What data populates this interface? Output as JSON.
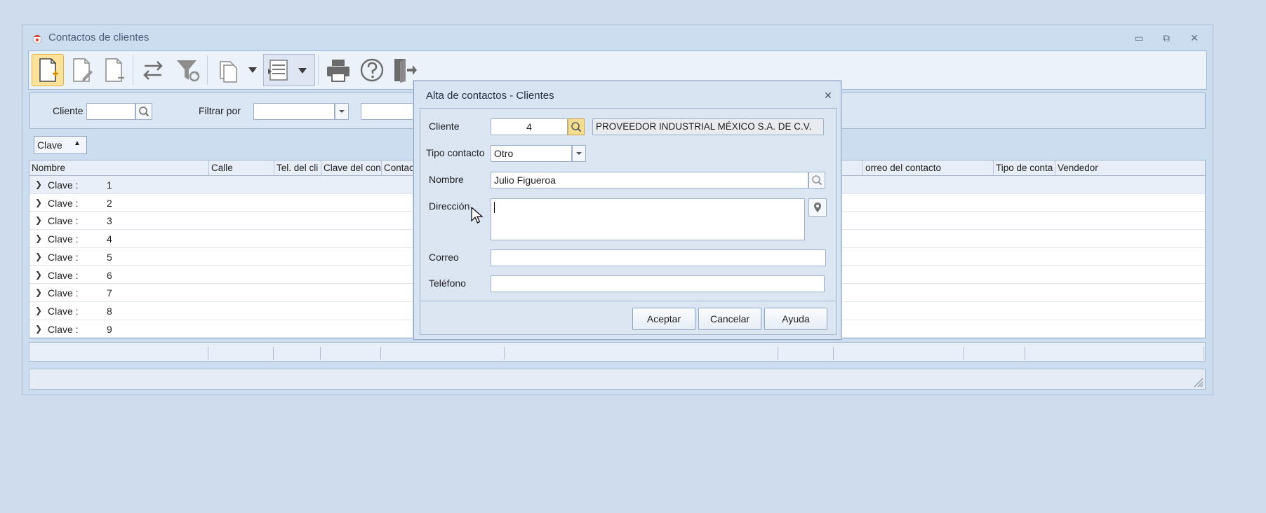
{
  "window": {
    "title": "Contactos de clientes",
    "minimize": "▭",
    "maximize": "⧉",
    "close": "✕"
  },
  "toolbar": {
    "buttons": [
      "new-document-icon",
      "edit-document-icon",
      "delete-document-icon",
      "swap-arrows-icon",
      "filter-refresh-icon",
      "copy-icon",
      "layout-icon",
      "print-icon",
      "help-icon",
      "exit-icon"
    ]
  },
  "filter": {
    "cliente_label": "Cliente",
    "cliente_value": "",
    "filtrar_label": "Filtrar por",
    "filtrar_value": "",
    "extra_value": ""
  },
  "group": {
    "label": "Clave",
    "arrow": "▲"
  },
  "grid": {
    "columns": [
      "Nombre",
      "Calle",
      "Tel. del cli",
      "Clave del con",
      "Contac",
      "orreo del contacto",
      "Tipo de conta",
      "Vendedor"
    ],
    "row_key": "Clave :",
    "rows": [
      "1",
      "2",
      "3",
      "4",
      "5",
      "6",
      "7",
      "8",
      "9"
    ]
  },
  "dialog": {
    "title": "Alta de contactos - Clientes",
    "close": "✕",
    "cliente_label": "Cliente",
    "cliente_value": "4",
    "cliente_name": "PROVEEDOR INDUSTRIAL MÉXICO S.A. DE C.V.",
    "tipo_label": "Tipo contacto",
    "tipo_value": "Otro",
    "nombre_label": "Nombre",
    "nombre_value": "Julio Figueroa",
    "direccion_label": "Dirección",
    "direccion_value": "",
    "correo_label": "Correo",
    "correo_value": "",
    "telefono_label": "Teléfono",
    "telefono_value": "",
    "aceptar": "Aceptar",
    "cancelar": "Cancelar",
    "ayuda": "Ayuda"
  },
  "colors": {
    "background": "#cfdced",
    "accent": "#fbe29a",
    "border": "#9fb6d3"
  }
}
